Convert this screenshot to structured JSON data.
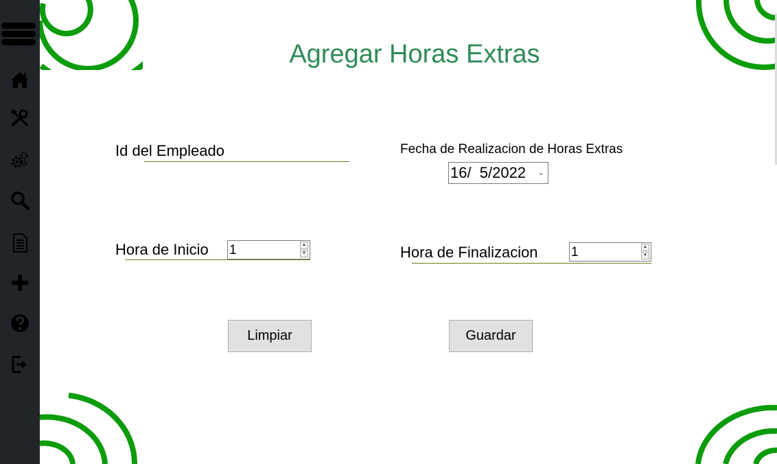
{
  "title": "Agregar Horas Extras",
  "fields": {
    "employee_id_label": "Id del Empleado",
    "employee_id_value": "",
    "date_label": "Fecha de Realizacion de Horas Extras",
    "date_value": "16/  5/2022",
    "start_label": "Hora de Inicio",
    "start_value": "1",
    "end_label": "Hora de Finalizacion",
    "end_value": "1"
  },
  "buttons": {
    "clear": "Limpiar",
    "save": "Guardar"
  },
  "sidebar": {
    "items": [
      {
        "icon": "home-icon"
      },
      {
        "icon": "tools-icon"
      },
      {
        "icon": "gears-icon"
      },
      {
        "icon": "search-icon"
      },
      {
        "icon": "document-icon"
      },
      {
        "icon": "plus-icon"
      },
      {
        "icon": "help-icon"
      },
      {
        "icon": "logout-icon"
      }
    ]
  },
  "colors": {
    "sidebar_bg": "#212529",
    "title": "#2e8b57",
    "spiral": "#0c9c0c"
  }
}
